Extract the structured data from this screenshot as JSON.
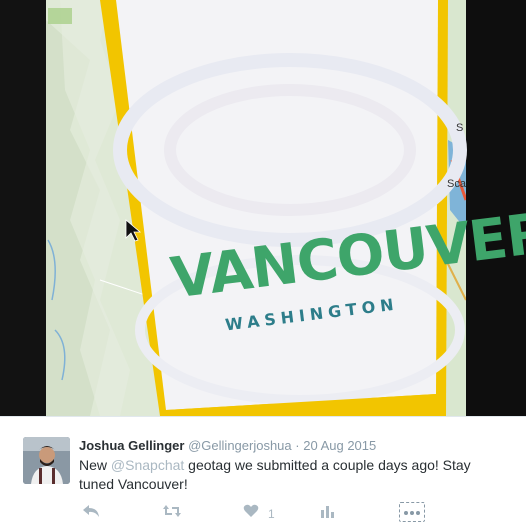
{
  "photo": {
    "alt": "",
    "map_labels": [
      "S",
      "Sca"
    ],
    "geotag": {
      "main_word": "VANCOUVER",
      "sub_word": "WASHINGTON"
    },
    "colors": {
      "border_yellow": "#f2c500",
      "screen_white": "#f3f3f6",
      "map_green": "#dce9d2",
      "vancouver_green": "#3ea56a",
      "washington_teal": "#2d7d8a"
    }
  },
  "tweet": {
    "display_name": "Joshua Gellinger",
    "handle": "@Gellingerjoshua",
    "separator": "·",
    "date": "20 Aug 2015",
    "text_before": "New ",
    "mention": "@Snapchat",
    "text_after": " geotag we submitted a couple days ago! Stay tuned Vancouver!",
    "like_count": "1",
    "icons": [
      "reply-icon",
      "retweet-icon",
      "heart-icon",
      "analytics-icon",
      "more-icon"
    ]
  }
}
